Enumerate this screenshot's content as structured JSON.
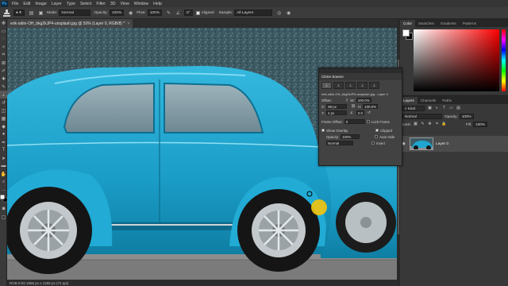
{
  "app_logo": "Ps",
  "menu": [
    "File",
    "Edit",
    "Image",
    "Layer",
    "Type",
    "Select",
    "Filter",
    "3D",
    "View",
    "Window",
    "Help"
  ],
  "options": {
    "mode_label": "Mode:",
    "mode_value": "Normal",
    "opacity_label": "Opacity:",
    "opacity_value": "100%",
    "flow_label": "Flow:",
    "flow_value": "100%",
    "angle_value": "0°",
    "aligned_label": "Aligned",
    "sample_label": "Sample:",
    "sample_value": "All Layers"
  },
  "document": {
    "tab_title": "erik-odiin-OH_bkg2kJP4-unsplash.jpg @ 50% (Layer 0, RGB/8) *",
    "close": "×",
    "status": "RGB 8-bit 1966 px x 1306 px (72 ppi)"
  },
  "color_panel": {
    "tabs": [
      "Color",
      "Swatches",
      "Gradients",
      "Patterns"
    ]
  },
  "layers_panel": {
    "tabs": [
      "Layers",
      "Channels",
      "Paths"
    ],
    "kind_label": "Kind",
    "blend_value": "Normal",
    "opacity_label": "Opacity:",
    "opacity_value": "100%",
    "lock_label": "Lock:",
    "fill_label": "Fill:",
    "fill_value": "100%",
    "layer_name": "Layer 0"
  },
  "clone_source": {
    "title": "Clone Source",
    "source_file": "erik-odiin-OH_bkg2kJP4-unsplash.jpg : Layer 0",
    "offset_label": "Offset:",
    "x_label": "X:",
    "x_value": "98 px",
    "y_label": "Y:",
    "y_value": "4 px",
    "w_label": "W:",
    "w_value": "100.0%",
    "h_label": "H:",
    "h_value": "100.0%",
    "angle_value": "0.0",
    "frame_offset_label": "Frame Offset:",
    "frame_offset_value": "0",
    "lock_frame_label": "Lock Frame",
    "show_overlay_label": "Show Overlay",
    "clipped_label": "Clipped",
    "overlay_opacity_label": "Opacity:",
    "overlay_opacity_value": "100%",
    "auto_hide_label": "Auto Hide",
    "invert_label": "Invert",
    "overlay_mode_value": "Normal"
  },
  "colors": {
    "car": "#1ea6cf",
    "wall": "#3f5a63",
    "ground": "#8c8c8c",
    "cursor": "#f1c40f"
  }
}
